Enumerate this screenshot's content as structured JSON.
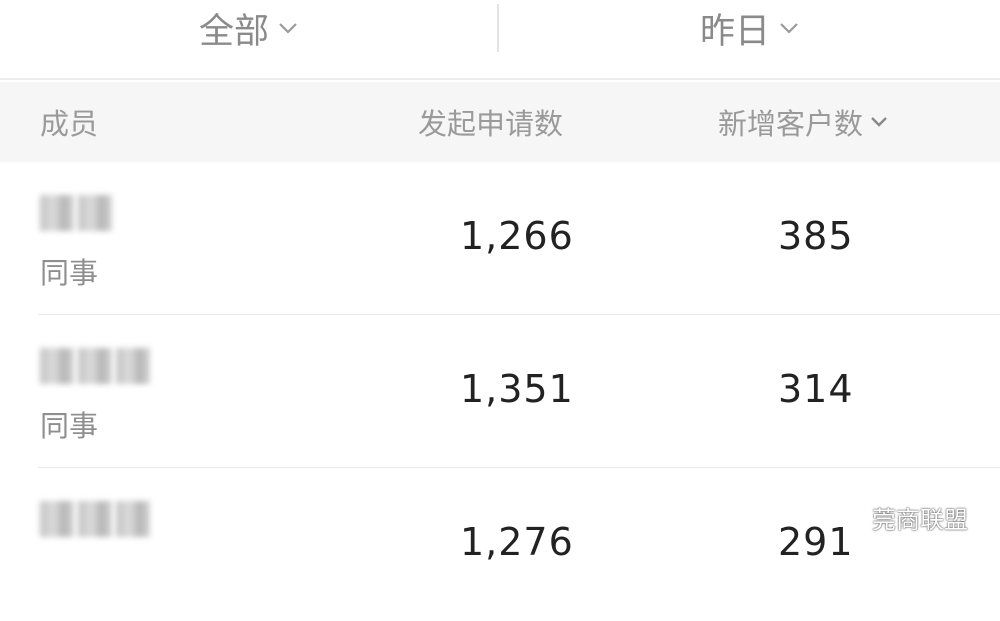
{
  "filters": {
    "scope": "全部",
    "period": "昨日"
  },
  "table": {
    "headers": {
      "member": "成员",
      "applications": "发起申请数",
      "new_customers": "新增客户数"
    },
    "rows": [
      {
        "role": "同事",
        "applications": "1,266",
        "new_customers": "385"
      },
      {
        "role": "同事",
        "applications": "1,351",
        "new_customers": "314"
      },
      {
        "role": "",
        "applications": "1,276",
        "new_customers": "291"
      }
    ]
  },
  "watermark": {
    "text": "莞商联盟",
    "icon": "wechat-icon"
  },
  "colors": {
    "header_bg": "#f6f6f6",
    "muted_text": "#8a8a8a",
    "value_text": "#222222"
  }
}
